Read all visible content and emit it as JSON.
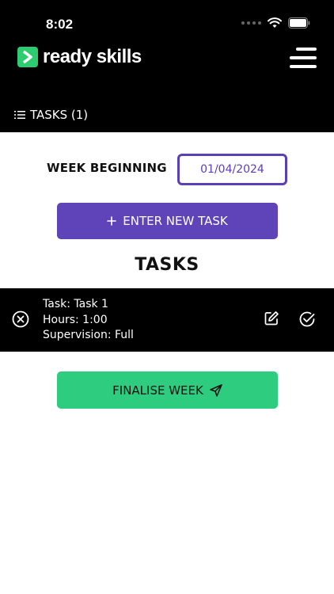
{
  "status_bar": {
    "time": "8:02"
  },
  "brand": {
    "name": "ready skills",
    "accent_color": "#2ecc71"
  },
  "header": {
    "tasks_label": "TASKS (1)"
  },
  "week": {
    "label": "WEEK BEGINNING",
    "date": "01/04/2024"
  },
  "actions": {
    "enter_task_label": "ENTER NEW TASK",
    "finalise_label": "FINALISE WEEK"
  },
  "tasks_section": {
    "title": "TASKS"
  },
  "tasks": [
    {
      "task": "Task: Task 1",
      "hours": "Hours: 1:00",
      "supervision": "Supervision: Full"
    }
  ],
  "colors": {
    "primary": "#5f43b8",
    "success": "#2ecc7f",
    "header_bg": "#000000"
  }
}
